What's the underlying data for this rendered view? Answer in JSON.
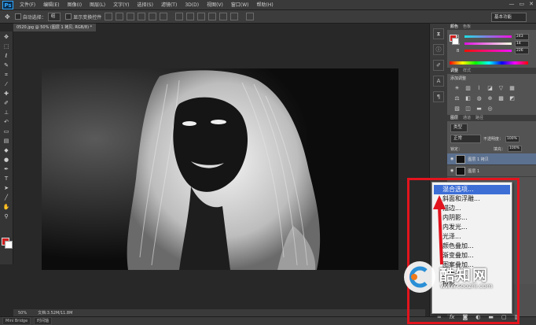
{
  "app": {
    "logo": "Ps"
  },
  "menubar": {
    "items": [
      "文件(F)",
      "编辑(E)",
      "图像(I)",
      "图层(L)",
      "文字(Y)",
      "选择(S)",
      "滤镜(T)",
      "3D(D)",
      "视图(V)",
      "窗口(W)",
      "帮助(H)"
    ],
    "window_controls": [
      "—",
      "▭",
      "✕"
    ]
  },
  "options": {
    "auto_select_label": "自动选择：",
    "auto_select_value": "组",
    "show_transform_label": "显示变换控件",
    "workspace": "基本功能"
  },
  "document": {
    "tab_title": "0520.jpg @ 50% (图层 1 拷贝, RGB/8) *"
  },
  "status": {
    "zoom": "50%",
    "doc_size": "文档:3.52M/11.8M"
  },
  "bottom_tabs": [
    "Mini Bridge",
    "时间轴"
  ],
  "color_panel": {
    "tabs": [
      "颜色",
      "色板"
    ],
    "channels": [
      {
        "label": "R",
        "value": "243"
      },
      {
        "label": "G",
        "value": "14"
      },
      {
        "label": "B",
        "value": "226"
      }
    ]
  },
  "adjustments_panel": {
    "tabs": [
      "调整",
      "样式"
    ],
    "title": "添加调整"
  },
  "layers_panel": {
    "tabs": [
      "图层",
      "通道",
      "路径"
    ],
    "kind_label": "类型",
    "blend_mode": "正常",
    "opacity_label": "不透明度：",
    "opacity_value": "100%",
    "lock_label": "锁定：",
    "fill_label": "填充：",
    "fill_value": "100%",
    "layers": [
      "图层 1 拷贝",
      "图层 1"
    ]
  },
  "context_menu": {
    "items": [
      "混合选项...",
      "斜面和浮雕...",
      "描边...",
      "内阴影...",
      "内发光...",
      "光泽...",
      "颜色叠加...",
      "渐变叠加...",
      "图案叠加...",
      "外发光...",
      "投影..."
    ],
    "highlighted_index": 0
  },
  "watermark": {
    "title": "酷知网",
    "url": "www.coozhi.com"
  },
  "colors": {
    "highlight": "#3d6ed6",
    "annotation_red": "#e2141e",
    "foreground": "#d11e1e",
    "background": "#ffffff"
  },
  "icons": [
    "move-icon",
    "marquee-icon",
    "lasso-icon",
    "quick-select-icon",
    "crop-icon",
    "eyedropper-icon",
    "healing-icon",
    "brush-icon",
    "stamp-icon",
    "history-brush-icon",
    "eraser-icon",
    "gradient-icon",
    "blur-icon",
    "dodge-icon",
    "pen-icon",
    "type-icon",
    "path-select-icon",
    "shape-icon",
    "hand-icon",
    "zoom-icon"
  ]
}
